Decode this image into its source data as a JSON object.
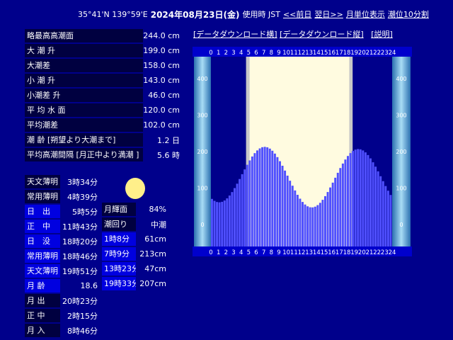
{
  "header": {
    "coords": "35°41'N 139°59'E",
    "date": "2024年08月23日(金)",
    "tz": "使用時 JST",
    "prev": "<<前日",
    "next": "翌日>>",
    "month": "月単位表示",
    "interval": "潮位10分割"
  },
  "stats": [
    {
      "label": "略最高高潮面",
      "value": "244.0 cm"
    },
    {
      "label": "大 潮 升",
      "value": "199.0 cm"
    },
    {
      "label": "大潮差",
      "value": "158.0 cm"
    },
    {
      "label": "小 潮 升",
      "value": "143.0 cm"
    },
    {
      "label": "小潮差 升",
      "value": "46.0 cm"
    },
    {
      "label": "平 均 水 面",
      "value": "120.0 cm"
    },
    {
      "label": "平均潮差",
      "value": "102.0 cm"
    },
    {
      "label": "潮 齢 [朔望より大潮まで]",
      "value": "1.2 日"
    },
    {
      "label": "平均高潮間隔 [月正中より満潮 ]",
      "value": "5.6 時"
    }
  ],
  "astro": [
    {
      "label": "天文薄明",
      "value": "3時34分"
    },
    {
      "label": "常用薄明",
      "value": "4時39分"
    },
    {
      "label": "日　出",
      "value": "5時5分"
    },
    {
      "label": "正　中",
      "value": "11時43分"
    },
    {
      "label": "日　没",
      "value": "18時20分"
    },
    {
      "label": "常用薄明",
      "value": "18時46分"
    },
    {
      "label": "天文薄明",
      "value": "19時51分"
    },
    {
      "label": "月 齢",
      "value": "18.6"
    },
    {
      "label": "月 出",
      "value": "20時23分"
    },
    {
      "label": "正 中",
      "value": "2時15分"
    },
    {
      "label": "月 入",
      "value": "8時46分"
    }
  ],
  "tide": [
    {
      "label": "月輝面",
      "value": "84%"
    },
    {
      "label": "潮回り",
      "value": "中潮"
    },
    {
      "label": "1時8分",
      "value": "61cm"
    },
    {
      "label": "7時9分",
      "value": "213cm"
    },
    {
      "label": "13時23分",
      "value": "47cm"
    },
    {
      "label": "19時33分",
      "value": "207cm"
    }
  ],
  "downloads": {
    "horizontal": "[データダウンロード横]",
    "vertical": "[データダウンロード縦]",
    "help": "[説明]"
  },
  "chart_data": {
    "type": "bar",
    "x_ticks": [
      "0",
      "1",
      "2",
      "3",
      "4",
      "5",
      "6",
      "7",
      "8",
      "9",
      "10",
      "11",
      "12",
      "13",
      "14",
      "15",
      "16",
      "17",
      "18",
      "19",
      "20",
      "21",
      "22",
      "23",
      "24"
    ],
    "y_ticks": [
      "0",
      "100",
      "200",
      "300",
      "400"
    ],
    "ylim": [
      -60,
      460
    ],
    "xlim": [
      0,
      24
    ],
    "twilight": {
      "civil_start": 4.65,
      "sunrise": 5.08,
      "sunset": 18.33,
      "civil_end": 18.77
    },
    "extrema": [
      {
        "t": 1.13,
        "h": 61
      },
      {
        "t": 7.15,
        "h": 213
      },
      {
        "t": 13.38,
        "h": 47
      },
      {
        "t": 19.55,
        "h": 207
      }
    ],
    "colors": {
      "bar": "#5050ff",
      "day": "#fffbe0",
      "twilight": "#c8c8c8",
      "night": "#00008b",
      "gauge": "#5aa8d6"
    }
  }
}
